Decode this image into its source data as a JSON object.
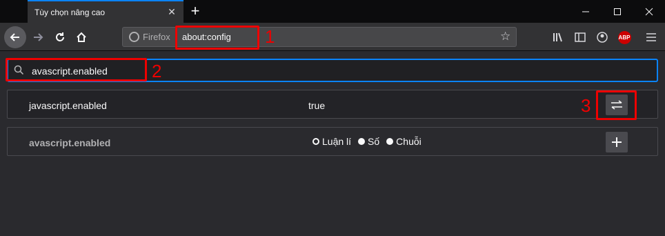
{
  "tab": {
    "title": "Tùy chọn nâng cao",
    "close_icon": "close-icon"
  },
  "toolbar": {
    "identity_label": "Firefox",
    "url": "about:config"
  },
  "search": {
    "value": "avascript.enabled"
  },
  "prefs": [
    {
      "name": "javascript.enabled",
      "value": "true",
      "action_icon": "toggle-icon"
    }
  ],
  "new_pref": {
    "name": "avascript.enabled",
    "types": [
      "Luận lí",
      "Số",
      "Chuỗi"
    ],
    "selected_type": "Luận lí",
    "action_icon": "add-icon"
  },
  "annotations": [
    "1",
    "2",
    "3"
  ],
  "colors": {
    "accent": "#0a84ff",
    "highlight": "#e00000",
    "abp": "#cc0000"
  }
}
